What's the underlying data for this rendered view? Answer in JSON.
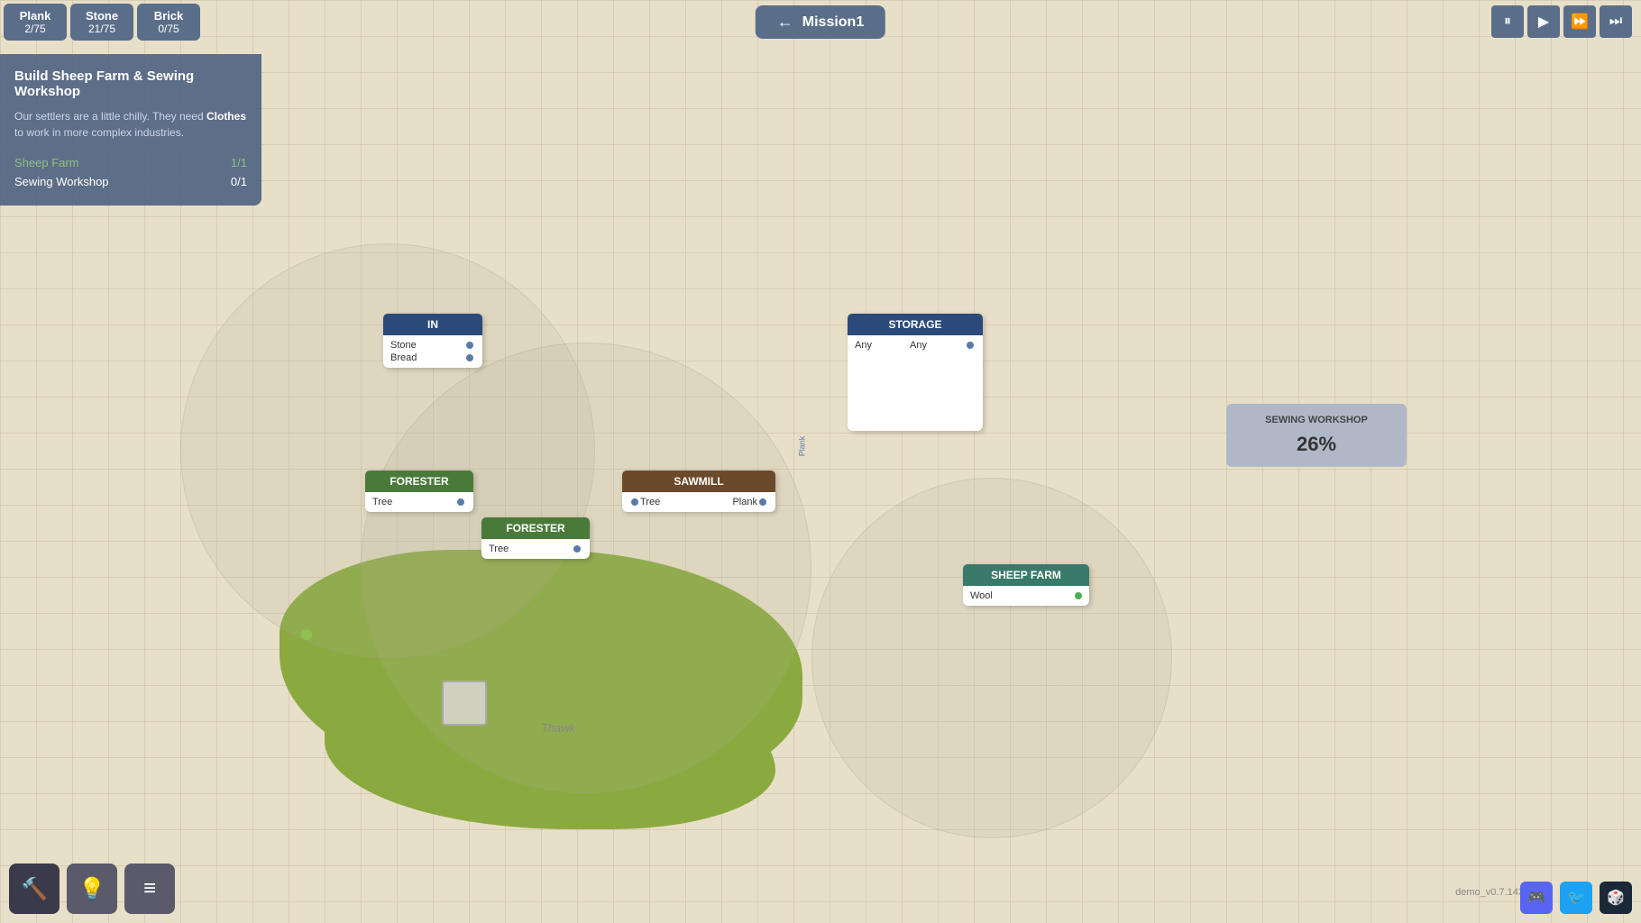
{
  "resources": [
    {
      "name": "Plank",
      "count": "2/75"
    },
    {
      "name": "Stone",
      "count": "21/75"
    },
    {
      "name": "Brick",
      "count": "0/75"
    }
  ],
  "mission": {
    "title": "Mission1",
    "back_label": "←"
  },
  "speed_controls": [
    "⏸",
    "▶",
    "⏩",
    "⏭"
  ],
  "panel": {
    "title": "Build Sheep Farm & Sewing Workshop",
    "description_prefix": "Our settlers are a little chilly. They need ",
    "description_keyword": "Clothes",
    "description_suffix": " to work in more complex industries.",
    "objectives": [
      {
        "label": "Sheep Farm",
        "progress": "1/1",
        "complete": true
      },
      {
        "label": "Sewing Workshop",
        "progress": "0/1",
        "complete": false
      }
    ]
  },
  "nodes": {
    "in_node": {
      "header": "IN",
      "inputs": [
        "Stone",
        "Bread"
      ]
    },
    "storage_node": {
      "header": "STORAGE",
      "left": "Any",
      "right": "Any"
    },
    "forester1": {
      "header": "FORESTER",
      "output": "Tree"
    },
    "forester2": {
      "header": "FORESTER",
      "output": "Tree"
    },
    "sawmill": {
      "header": "SAWMILL",
      "input": "Tree",
      "output": "Plank"
    },
    "sheep_farm": {
      "header": "SHEEP FARM",
      "output": "Wool"
    }
  },
  "sewing_workshop": {
    "title": "SEWING WORKSHOP",
    "percent": "26%"
  },
  "map_label": "Thawk",
  "version": "demo_v0.7.143",
  "toolbar": {
    "hammer": "🔨",
    "bulb": "💡",
    "menu": "≡"
  }
}
